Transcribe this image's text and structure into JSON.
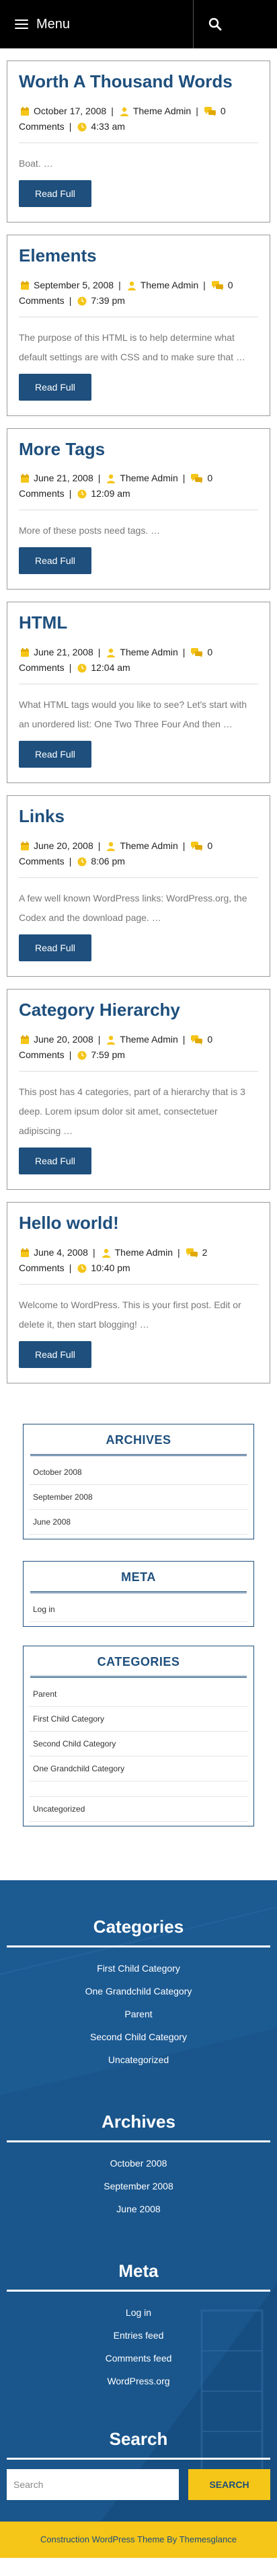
{
  "header": {
    "menu_label": "Menu",
    "menu_icon": "hamburger-icon",
    "search_icon": "search-icon"
  },
  "posts": [
    {
      "title": "Worth A Thousand Words",
      "date": "October 17, 2008",
      "author": "Theme Admin",
      "comments": "0",
      "comments_label": "Comments",
      "time": "4:33 am",
      "excerpt": "Boat. …",
      "read_more": "Read Full"
    },
    {
      "title": "Elements",
      "date": "September 5, 2008",
      "author": "Theme Admin",
      "comments": "0",
      "comments_label": "Comments",
      "time": "7:39 pm",
      "excerpt": "The purpose of this HTML is to help determine what default settings are with CSS and to make sure that …",
      "read_more": "Read Full"
    },
    {
      "title": "More Tags",
      "date": "June 21, 2008",
      "author": "Theme Admin",
      "comments": "0",
      "comments_label": "Comments",
      "time": "12:09 am",
      "excerpt": "More of these posts need tags. …",
      "read_more": "Read Full"
    },
    {
      "title": "HTML",
      "date": "June 21, 2008",
      "author": "Theme Admin",
      "comments": "0",
      "comments_label": "Comments",
      "time": "12:04 am",
      "excerpt": "What HTML tags would you like to see? Let's start with an unordered list: One Two Three Four And then …",
      "read_more": "Read Full"
    },
    {
      "title": "Links",
      "date": "June 20, 2008",
      "author": "Theme Admin",
      "comments": "0",
      "comments_label": "Comments",
      "time": "8:06 pm",
      "excerpt": "A few well known WordPress links: WordPress.org, the Codex and the download page. …",
      "read_more": "Read Full"
    },
    {
      "title": "Category Hierarchy",
      "date": "June 20, 2008",
      "author": "Theme Admin",
      "comments": "0",
      "comments_label": "Comments",
      "time": "7:59 pm",
      "excerpt": "This post has 4 categories, part of a hierarchy that is 3 deep. Lorem ipsum dolor sit amet, consectetuer adipiscing …",
      "read_more": "Read Full"
    },
    {
      "title": "Hello world!",
      "date": "June 4, 2008",
      "author": "Theme Admin",
      "comments": "2",
      "comments_label": "Comments",
      "time": "10:40 pm",
      "excerpt": "Welcome to WordPress. This is your first post. Edit or delete it, then start blogging! …",
      "read_more": "Read Full"
    }
  ],
  "sidebar": {
    "archives": {
      "title": "ARCHIVES",
      "items": [
        "October 2008",
        "September 2008",
        "June 2008"
      ]
    },
    "meta": {
      "title": "META",
      "items": [
        "Log in"
      ]
    },
    "categories": {
      "title": "CATEGORIES",
      "items": [
        "Parent",
        "First Child Category",
        "Second Child Category",
        "One Grandchild Category",
        "",
        "Uncategorized"
      ]
    }
  },
  "footer": {
    "categories": {
      "title": "Categories",
      "items": [
        "First Child Category",
        "One Grandchild Category",
        "Parent",
        "Second Child Category",
        "Uncategorized"
      ]
    },
    "archives": {
      "title": "Archives",
      "items": [
        "October 2008",
        "September 2008",
        "June 2008"
      ]
    },
    "meta": {
      "title": "Meta",
      "items": [
        "Log in",
        "Entries feed",
        "Comments feed",
        "WordPress.org"
      ]
    },
    "search": {
      "title": "Search",
      "placeholder": "Search",
      "button": "SEARCH"
    }
  },
  "credits": "Construction WordPress Theme By Themesglance",
  "colors": {
    "primary": "#1e4f7d",
    "accent": "#f5c518",
    "footer_bg": "#1a568c"
  }
}
